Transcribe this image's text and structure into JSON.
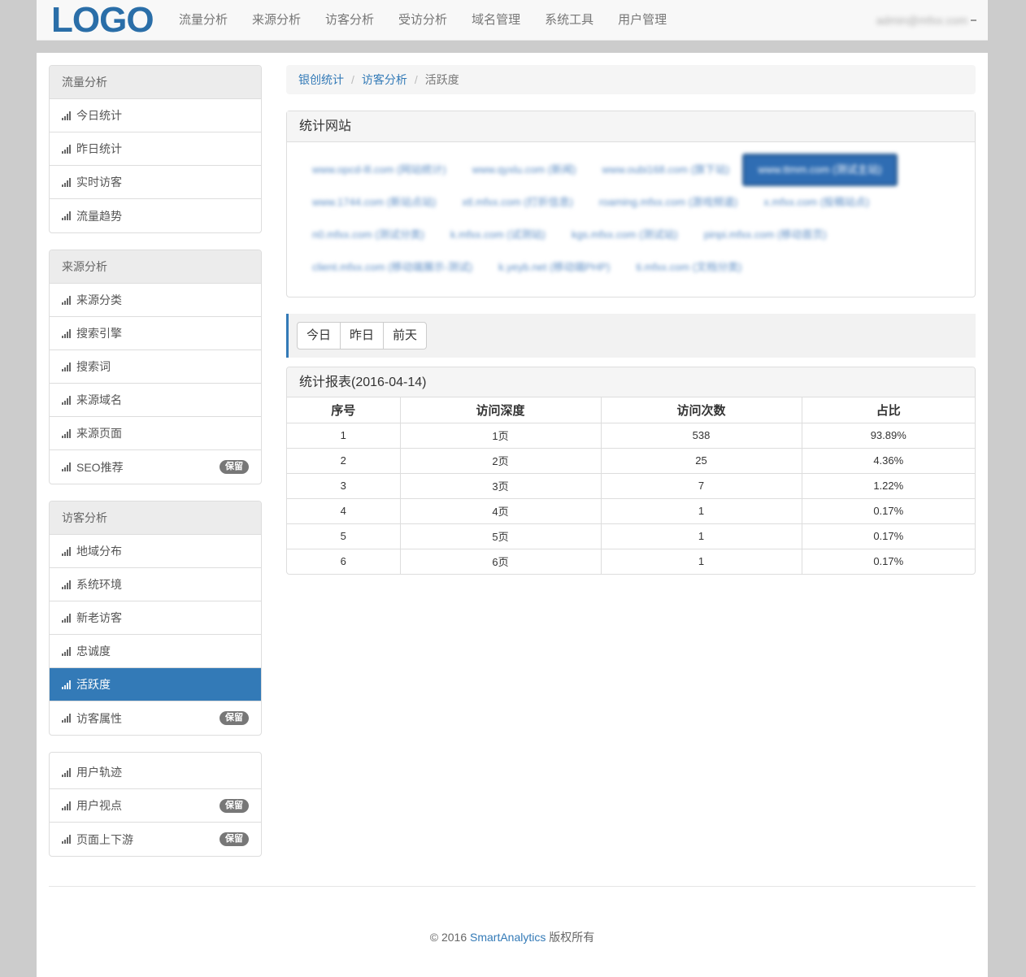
{
  "brand": {
    "logo": "LOGO"
  },
  "nav": {
    "items": [
      "流量分析",
      "来源分析",
      "访客分析",
      "受访分析",
      "域名管理",
      "系统工具",
      "用户管理"
    ],
    "user": "admin@mfxx.com"
  },
  "sidebar": {
    "groups": [
      {
        "title": "流量分析",
        "items": [
          {
            "label": "今日统计"
          },
          {
            "label": "昨日统计"
          },
          {
            "label": "实时访客"
          },
          {
            "label": "流量趋势"
          }
        ]
      },
      {
        "title": "来源分析",
        "items": [
          {
            "label": "来源分类"
          },
          {
            "label": "搜索引擎"
          },
          {
            "label": "搜索词"
          },
          {
            "label": "来源域名"
          },
          {
            "label": "来源页面"
          },
          {
            "label": "SEO推荐",
            "badge": "保留"
          }
        ]
      },
      {
        "title": "访客分析",
        "items": [
          {
            "label": "地域分布"
          },
          {
            "label": "系统环境"
          },
          {
            "label": "新老访客"
          },
          {
            "label": "忠诚度"
          },
          {
            "label": "活跃度",
            "active": true
          },
          {
            "label": "访客属性",
            "badge": "保留"
          }
        ]
      },
      {
        "title": "",
        "items": [
          {
            "label": "用户轨迹"
          },
          {
            "label": "用户视点",
            "badge": "保留"
          },
          {
            "label": "页面上下游",
            "badge": "保留"
          }
        ]
      }
    ]
  },
  "breadcrumb": {
    "root": "银创统计",
    "section": "访客分析",
    "current": "活跃度"
  },
  "sites_panel": {
    "title": "统计网站",
    "sites": [
      {
        "label": "www.opcd-lll.com (网站统计)"
      },
      {
        "label": "www.qyxlu.com (新闻)"
      },
      {
        "label": "www.oubi168.com (旗下站)"
      },
      {
        "label": "www.ttmm.com (测试主站)",
        "active": true
      },
      {
        "label": "www.1744.com (新站点站)"
      },
      {
        "label": "xtl.mfxx.com (打折信息)"
      },
      {
        "label": "roaming.mfxx.com (游戏频道)"
      },
      {
        "label": "x.mfxx.com (投稿站点)"
      },
      {
        "label": "n0.mfxx.com (测试分类)"
      },
      {
        "label": "k.mfxx.com (试测站)"
      },
      {
        "label": "kgs.mfxx.com (测试站)"
      },
      {
        "label": "pinpi.mfxx.com (移动首页)"
      },
      {
        "label": "client.mfxx.com (移动端展示-测试)"
      },
      {
        "label": "k.yeyb.net (移动端PHP)"
      },
      {
        "label": "ti.mfxx.com (文档分类)"
      }
    ]
  },
  "range": {
    "buttons": [
      "今日",
      "昨日",
      "前天"
    ]
  },
  "report": {
    "title": "统计报表(2016-04-14)",
    "columns": [
      "序号",
      "访问深度",
      "访问次数",
      "占比"
    ],
    "rows": [
      [
        "1",
        "1页",
        "538",
        "93.89%"
      ],
      [
        "2",
        "2页",
        "25",
        "4.36%"
      ],
      [
        "3",
        "3页",
        "7",
        "1.22%"
      ],
      [
        "4",
        "4页",
        "1",
        "0.17%"
      ],
      [
        "5",
        "5页",
        "1",
        "0.17%"
      ],
      [
        "6",
        "6页",
        "1",
        "0.17%"
      ]
    ]
  },
  "footer": {
    "prefix": "© 2016 ",
    "brand": "SmartAnalytics",
    "suffix": " 版权所有"
  }
}
